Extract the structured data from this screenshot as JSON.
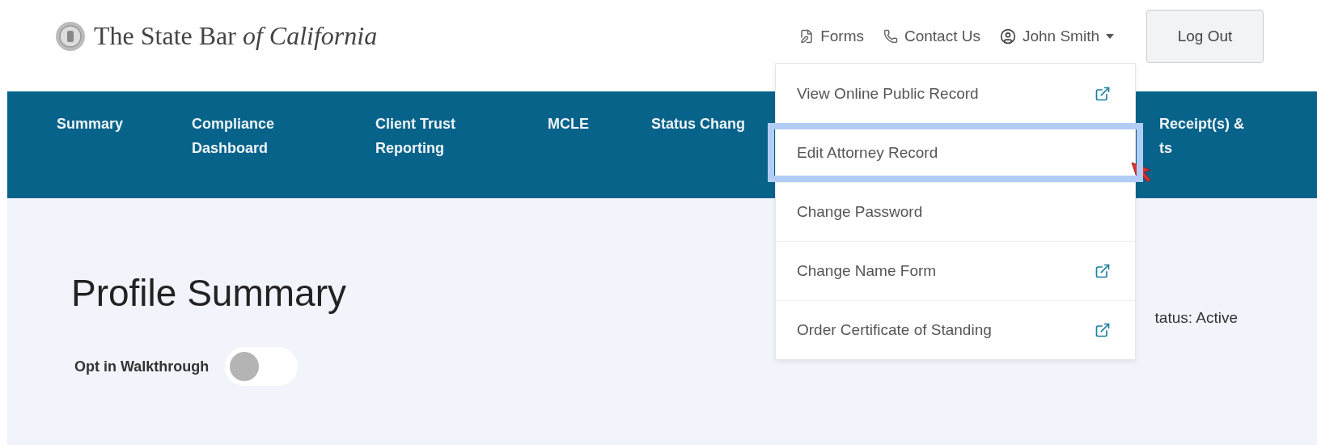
{
  "header": {
    "logo": "The State Bar *of California*",
    "links": [
      {
        "kind": "forms",
        "label": "Forms"
      },
      {
        "kind": "phone",
        "label": "Contact Us"
      },
      {
        "kind": "user",
        "label": "John Smith",
        "expanded": true
      }
    ],
    "logout": "Log Out"
  },
  "nav": [
    {
      "lines": [
        "Summary"
      ]
    },
    {
      "lines": [
        "Compliance",
        "Dashboard"
      ]
    },
    {
      "lines": [
        "Client Trust",
        "Reporting"
      ]
    },
    {
      "lines": [
        "MCLE"
      ]
    },
    {
      "lines": [
        "Status Chang"
      ]
    },
    {
      "lines": [
        "Receipt(s) &",
        "ts"
      ]
    }
  ],
  "user_menu": [
    {
      "label": "View Online Public Record",
      "external": true,
      "selected": false
    },
    {
      "label": "Edit Attorney Record",
      "external": false,
      "selected": true
    },
    {
      "label": "Change Password",
      "external": false,
      "selected": false
    },
    {
      "label": "Change Name Form",
      "external": true,
      "selected": false
    },
    {
      "label": "Order Certificate of Standing",
      "external": true,
      "selected": false
    }
  ],
  "page": {
    "title": "Profile Summary",
    "status": "tatus: Active",
    "walkthrough": {
      "label": "Opt in Walkthrough",
      "on": false
    }
  }
}
